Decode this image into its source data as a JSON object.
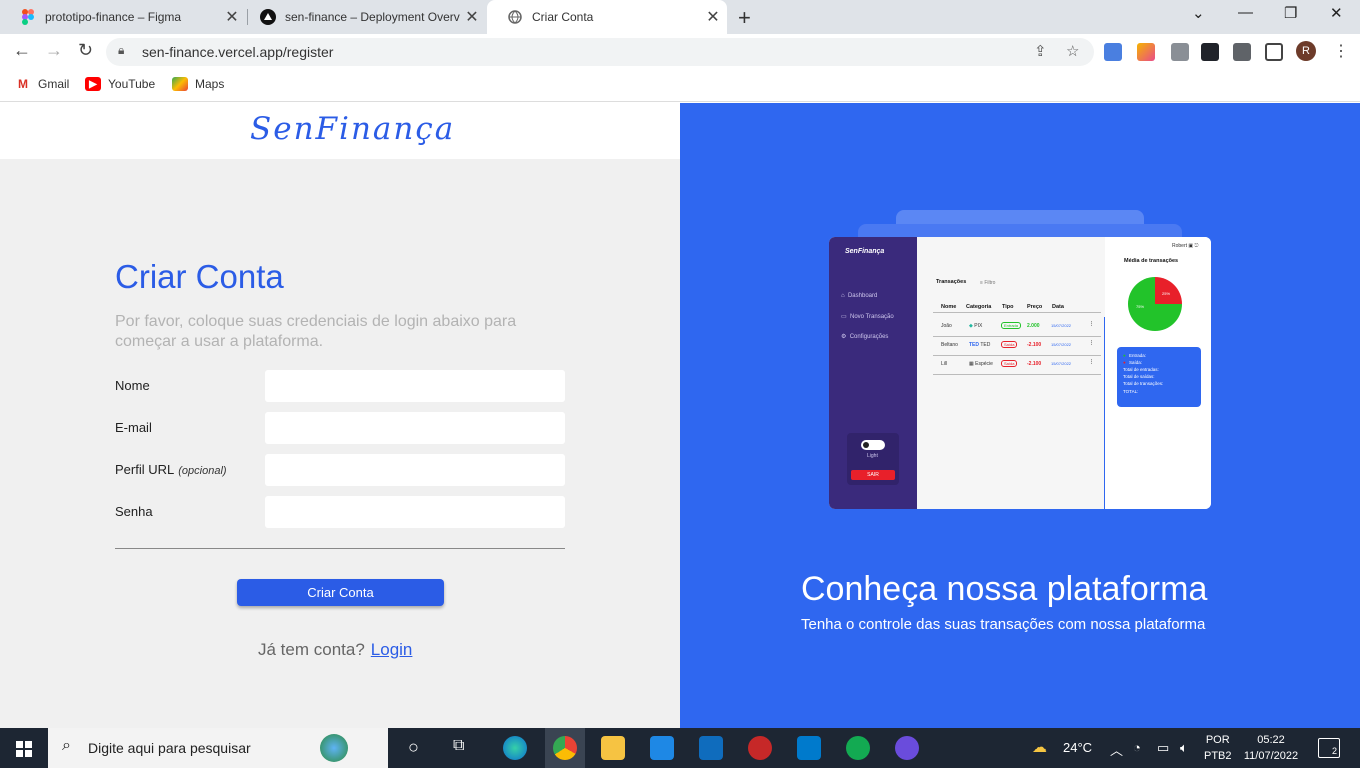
{
  "browser": {
    "tabs": [
      {
        "title": "prototipo-finance – Figma",
        "icon": "figma-icon"
      },
      {
        "title": "sen-finance – Deployment Overv",
        "icon": "vercel-icon"
      },
      {
        "title": "Criar Conta",
        "icon": "globe-icon",
        "active": true
      }
    ],
    "url": "sen-finance.vercel.app/register",
    "bookmarks": [
      {
        "label": "Gmail",
        "icon": "gmail-icon"
      },
      {
        "label": "YouTube",
        "icon": "youtube-icon"
      },
      {
        "label": "Maps",
        "icon": "maps-icon"
      }
    ],
    "profile_initial": "R"
  },
  "page": {
    "logo": "SenFinança",
    "title": "Criar Conta",
    "subtitle": "Por favor, coloque suas credenciais de login abaixo para começar a usar a plataforma.",
    "fields": {
      "name_label": "Nome",
      "email_label": "E-mail",
      "profile_label": "Perfil URL",
      "profile_optional": "(opcional)",
      "password_label": "Senha"
    },
    "submit_label": "Criar Conta",
    "have_account": "Já tem conta?",
    "login_link": "Login",
    "promo_title": "Conheça nossa plataforma",
    "promo_subtitle": "Tenha o controle das suas transações com nossa plataforma"
  },
  "preview": {
    "logo": "SenFinança",
    "user": "Robert",
    "nav": [
      "Dashboard",
      "Novo Transação",
      "Configurações"
    ],
    "toggle_label": "Light",
    "logout": "SAIR",
    "transactions_title": "Transações",
    "filter": "Filtro",
    "columns": [
      "Nome",
      "Categoria",
      "Tipo",
      "Preço",
      "Data"
    ],
    "rows": [
      {
        "name": "João",
        "category": "PIX",
        "type": "Entrada",
        "price": "2.000",
        "date": "15/07/2022"
      },
      {
        "name": "Beltano",
        "category": "TED",
        "type": "Saída",
        "price": "-2.100",
        "date": "15/07/2022"
      },
      {
        "name": "Lill",
        "category": "Espécie",
        "type": "Saída",
        "price": "-2.100",
        "date": "15/07/2022"
      }
    ],
    "stats_title": "Média de transações",
    "pie": {
      "red_percent": "25%",
      "green_percent": "75%"
    },
    "card": [
      "Entrada:",
      "Saída:",
      "Total de entradas:",
      "Total de saídas:",
      "Total de transações:",
      "TOTAL:"
    ]
  },
  "taskbar": {
    "search_placeholder": "Digite aqui para pesquisar",
    "weather": "24°C",
    "lang": "POR",
    "layout": "PTB2",
    "time": "05:22",
    "date": "11/07/2022",
    "notifications": "2"
  }
}
